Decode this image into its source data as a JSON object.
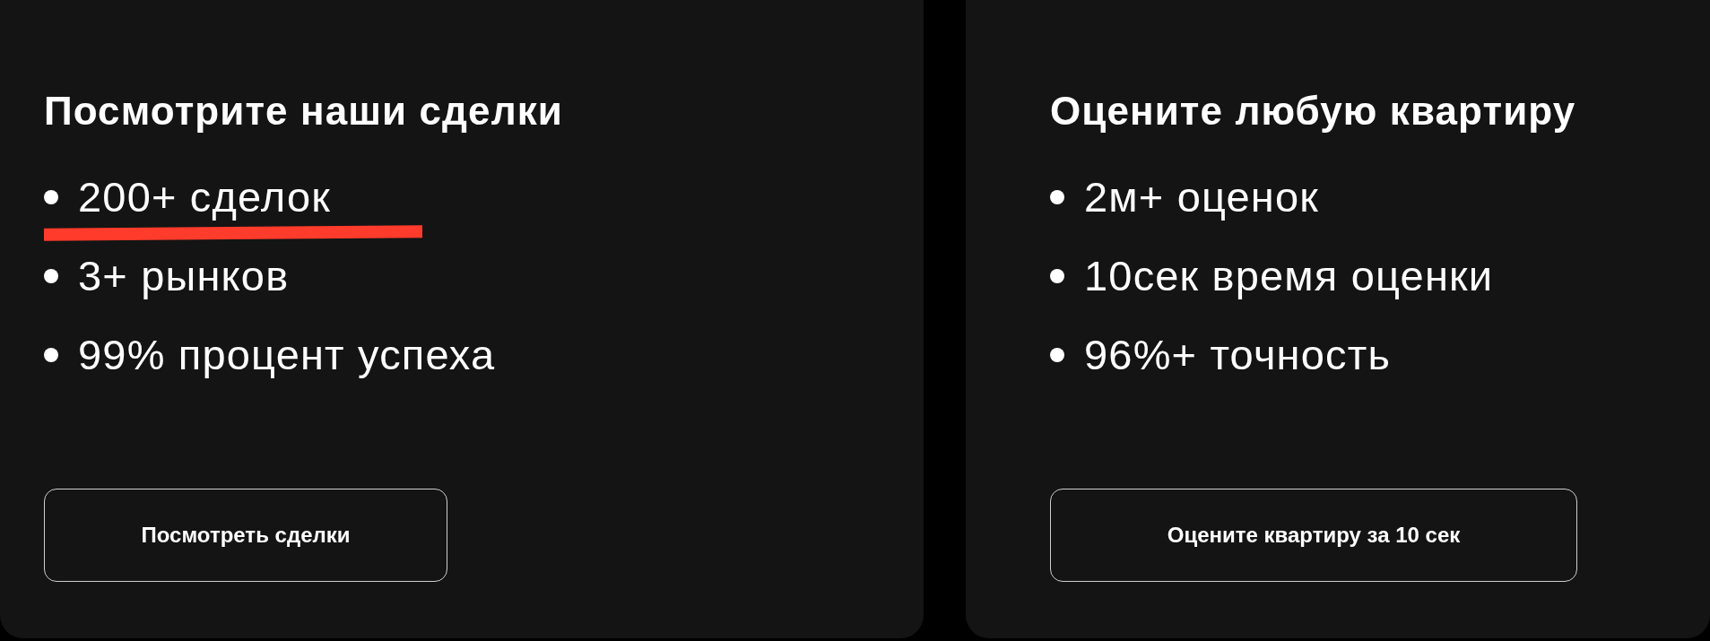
{
  "cards": [
    {
      "title": "Посмотрите наши сделки",
      "items": [
        {
          "text": "200+ сделок",
          "highlighted": true
        },
        {
          "text": "3+ рынков",
          "highlighted": false
        },
        {
          "text": "99% процент успеха",
          "highlighted": false
        }
      ],
      "button": "Посмотреть сделки"
    },
    {
      "title": "Оцените любую квартиру",
      "items": [
        {
          "text": "2м+ оценок",
          "highlighted": false
        },
        {
          "text": "10сек время оценки",
          "highlighted": false
        },
        {
          "text": "96%+ точность",
          "highlighted": false
        }
      ],
      "button": "Оцените квартиру за 10 сек"
    }
  ]
}
